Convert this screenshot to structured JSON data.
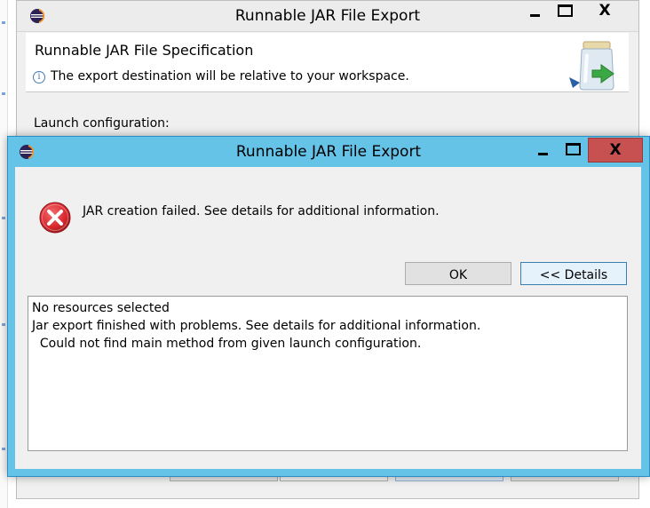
{
  "background_window": {
    "title": "Runnable JAR File Export",
    "spec_title": "Runnable JAR File Specification",
    "info_text": "The export destination will be relative to your workspace.",
    "launch_label": "Launch configuration:",
    "info_icon": "i"
  },
  "window_controls": {
    "minimize_icon": "minimize-icon",
    "maximize_icon": "maximize-icon",
    "close_glyph": "X"
  },
  "dialog": {
    "title": "Runnable JAR File Export",
    "message": "JAR creation failed. See details for additional information.",
    "ok_label": "OK",
    "details_label": "<< Details",
    "details_lines": [
      "No resources selected",
      "Jar export finished with problems. See details for additional information.",
      "  Could not find main method from given launch configuration."
    ]
  },
  "colors": {
    "active_titlebar": "#65c3e8",
    "close_button": "#c75050",
    "error_red": "#d9282f"
  }
}
